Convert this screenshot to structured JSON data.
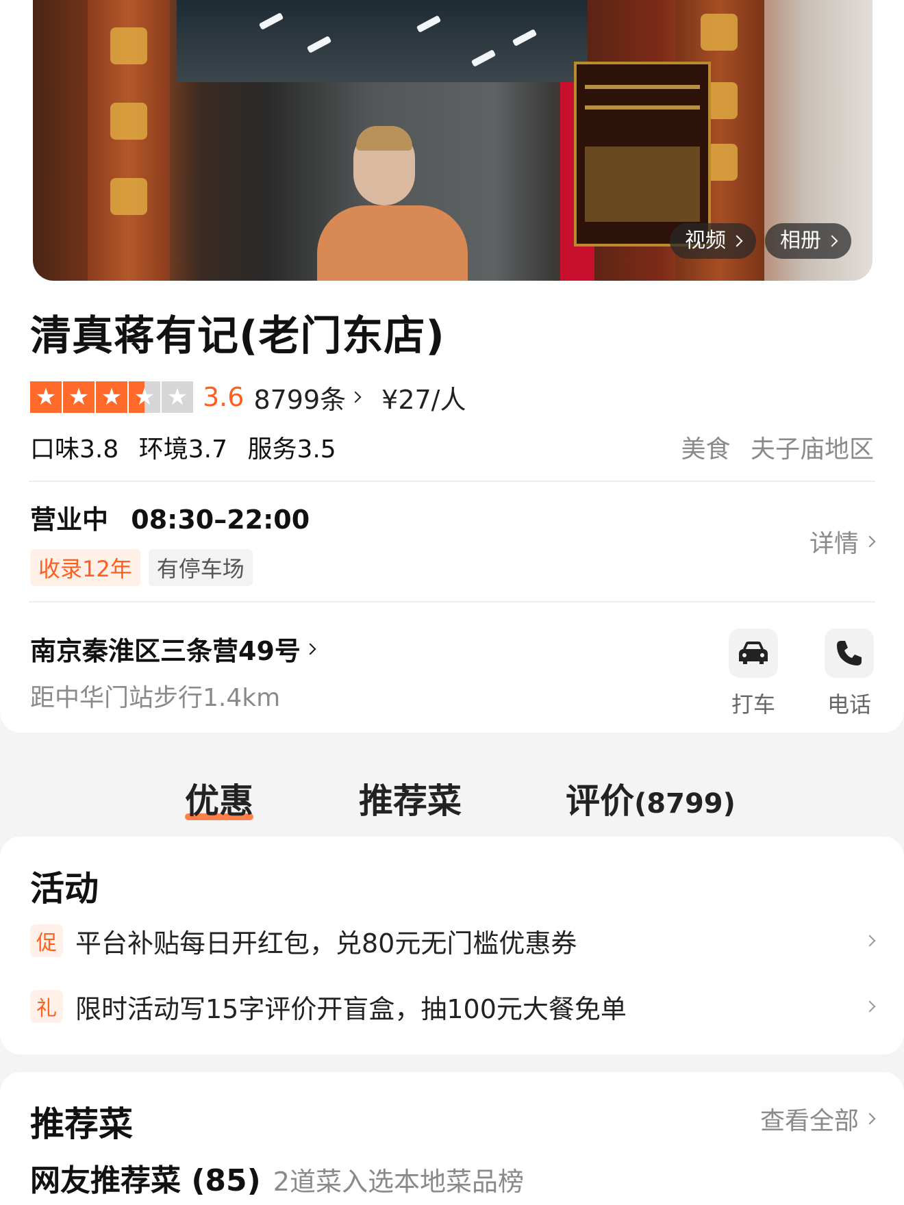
{
  "hero": {
    "video_button": "视频",
    "album_button": "相册"
  },
  "store": {
    "name": "清真蒋有记(老门东店)",
    "rating": "3.6",
    "rating_value": 3.6,
    "review_count": "8799条",
    "price": "¥27/人",
    "scores": [
      "口味3.8",
      "环境3.7",
      "服务3.5"
    ],
    "category": "美食",
    "area": "夫子庙地区",
    "status": "营业中",
    "hours": "08:30–22:00",
    "details_label": "详情",
    "badges": [
      "收录12年",
      "有停车场"
    ],
    "address": "南京秦淮区三条营49号",
    "distance": "距中华门站步行1.4km",
    "actions": {
      "taxi": "打车",
      "phone": "电话"
    }
  },
  "tabs": {
    "discount": "优惠",
    "dishes": "推荐菜",
    "reviews": "评价",
    "reviews_count": "(8799)"
  },
  "activity": {
    "title": "活动",
    "items": [
      {
        "tag": "促",
        "text": "平台补贴每日开红包，兑80元无门槛优惠券"
      },
      {
        "tag": "礼",
        "text": "限时活动写15字评价开盲盒，抽100元大餐免单"
      }
    ]
  },
  "dishes": {
    "title": "推荐菜",
    "see_all": "查看全部",
    "subtitle": "网友推荐菜 (85)",
    "note": "2道菜入选本地菜品榜"
  },
  "colors": {
    "accent": "#ff6a2b",
    "muted": "#8a8a8a"
  }
}
